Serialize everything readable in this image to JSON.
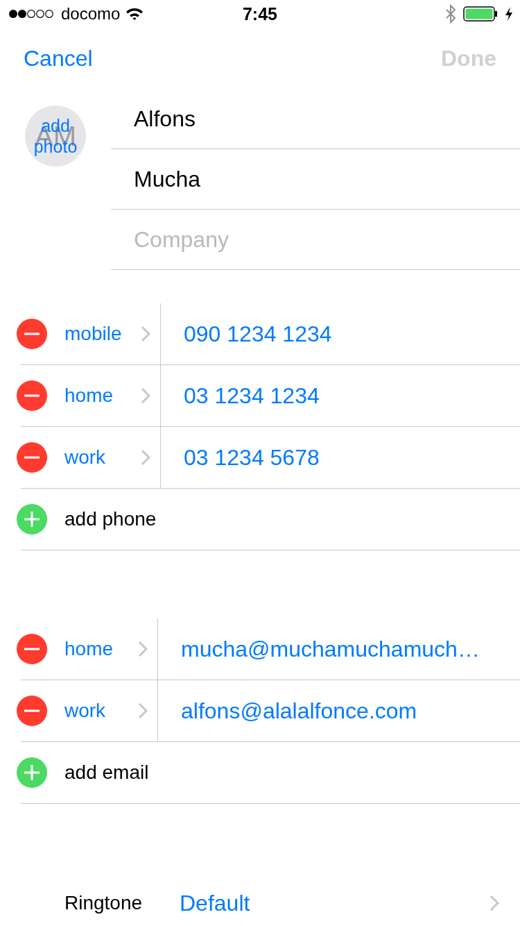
{
  "status_bar": {
    "carrier": "docomo",
    "time": "7:45"
  },
  "nav": {
    "cancel": "Cancel",
    "done": {
      "label": "Done",
      "disabled": true
    }
  },
  "photo": {
    "label": "add photo",
    "initials": "AM"
  },
  "name_fields": [
    {
      "value": "Alfons"
    },
    {
      "value": "Mucha"
    },
    {
      "placeholder": "Company"
    }
  ],
  "phones": {
    "entries": [
      {
        "label": "mobile",
        "value": "090 1234 1234"
      },
      {
        "label": "home",
        "value": "03 1234 1234"
      },
      {
        "label": "work",
        "value": "03 1234 5678"
      }
    ],
    "add_label": "add phone"
  },
  "emails": {
    "entries": [
      {
        "label": "home",
        "value": "mucha@muchamuchamuch…"
      },
      {
        "label": "work",
        "value": "alfons@alalalfonce.com"
      }
    ],
    "add_label": "add email"
  },
  "ringtone": {
    "label": "Ringtone",
    "value": "Default"
  }
}
